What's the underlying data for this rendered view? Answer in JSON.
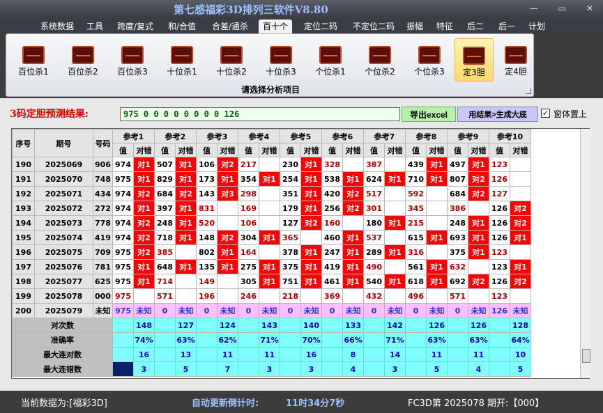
{
  "title": "第七感福彩3D排列三软件V8.80",
  "window_buttons": [
    "—",
    "▭",
    "✕"
  ],
  "menu": [
    "系统数据",
    "工具",
    "跨度/复式",
    "和/合值",
    "合差/通杀",
    "百十个",
    "定位二码",
    "不定位二码",
    "振幅",
    "特征",
    "后二",
    "后一",
    "计划"
  ],
  "active_menu": "百十个",
  "ribbon": {
    "buttons": [
      "百位杀1",
      "百位杀2",
      "百位杀3",
      "十位杀1",
      "十位杀2",
      "十位杀3",
      "个位杀1",
      "个位杀2",
      "个位杀3",
      "定3胆",
      "定4胆"
    ],
    "selected": "定3胆",
    "caption": "请选择分析项目"
  },
  "prediction": {
    "label": "3码定胆预测结果:",
    "value": "975 0 0 0 0 0 0 0 0 126",
    "excel_button": "导出excel",
    "gen_button": "用结果>生成大底",
    "checkbox_label": "窗体置上",
    "checkbox_checked": "✓"
  },
  "table": {
    "headers": {
      "no": "序号",
      "issue": "期号",
      "num": "号码",
      "val": "值",
      "hit": "对错",
      "refs": [
        "参考1",
        "参考2",
        "参考3",
        "参考4",
        "参考5",
        "参考6",
        "参考7",
        "参考8",
        "参考9",
        "参考10"
      ]
    },
    "rows": [
      {
        "no": "190",
        "issue": "2025069",
        "num": "906",
        "cells": [
          [
            "974",
            "对1"
          ],
          [
            "507",
            "对1"
          ],
          [
            "106",
            "对2"
          ],
          [
            "217",
            ""
          ],
          [
            "230",
            "对1"
          ],
          [
            "328",
            ""
          ],
          [
            "387",
            ""
          ],
          [
            "439",
            "对1"
          ],
          [
            "497",
            "对1"
          ],
          [
            "123",
            ""
          ]
        ]
      },
      {
        "no": "191",
        "issue": "2025070",
        "num": "748",
        "cells": [
          [
            "975",
            "对1"
          ],
          [
            "829",
            "对1"
          ],
          [
            "173",
            "对1"
          ],
          [
            "354",
            "对1"
          ],
          [
            "254",
            "对1"
          ],
          [
            "538",
            "对1"
          ],
          [
            "624",
            "对1"
          ],
          [
            "710",
            "对1"
          ],
          [
            "807",
            "对2"
          ],
          [
            "126",
            ""
          ]
        ]
      },
      {
        "no": "192",
        "issue": "2025071",
        "num": "434",
        "cells": [
          [
            "974",
            "对2"
          ],
          [
            "684",
            "对2"
          ],
          [
            "143",
            "对3"
          ],
          [
            "298",
            ""
          ],
          [
            "351",
            "对1"
          ],
          [
            "420",
            "对2"
          ],
          [
            "517",
            ""
          ],
          [
            "592",
            ""
          ],
          [
            "684",
            "对2"
          ],
          [
            "127",
            ""
          ]
        ]
      },
      {
        "no": "193",
        "issue": "2025072",
        "num": "272",
        "cells": [
          [
            "974",
            "对1"
          ],
          [
            "397",
            "对1"
          ],
          [
            "831",
            ""
          ],
          [
            "169",
            ""
          ],
          [
            "179",
            "对1"
          ],
          [
            "256",
            "对2"
          ],
          [
            "301",
            ""
          ],
          [
            "345",
            ""
          ],
          [
            "386",
            ""
          ],
          [
            "126",
            "对2"
          ]
        ]
      },
      {
        "no": "194",
        "issue": "2025073",
        "num": "778",
        "cells": [
          [
            "974",
            "对2"
          ],
          [
            "248",
            "对1"
          ],
          [
            "520",
            ""
          ],
          [
            "106",
            ""
          ],
          [
            "127",
            "对2"
          ],
          [
            "160",
            ""
          ],
          [
            "180",
            "对1"
          ],
          [
            "215",
            ""
          ],
          [
            "248",
            "对1"
          ],
          [
            "126",
            "对2"
          ]
        ]
      },
      {
        "no": "195",
        "issue": "2025074",
        "num": "419",
        "cells": [
          [
            "974",
            "对2"
          ],
          [
            "718",
            "对1"
          ],
          [
            "148",
            "对2"
          ],
          [
            "304",
            "对1"
          ],
          [
            "365",
            ""
          ],
          [
            "460",
            "对1"
          ],
          [
            "537",
            ""
          ],
          [
            "615",
            "对1"
          ],
          [
            "693",
            "对1"
          ],
          [
            "126",
            "对1"
          ]
        ]
      },
      {
        "no": "196",
        "issue": "2025075",
        "num": "709",
        "cells": [
          [
            "975",
            "对2"
          ],
          [
            "385",
            ""
          ],
          [
            "802",
            "对1"
          ],
          [
            "164",
            ""
          ],
          [
            "378",
            "对1"
          ],
          [
            "247",
            "对1"
          ],
          [
            "289",
            "对1"
          ],
          [
            "316",
            ""
          ],
          [
            "375",
            "对1"
          ],
          [
            "123",
            ""
          ]
        ]
      },
      {
        "no": "197",
        "issue": "2025076",
        "num": "781",
        "cells": [
          [
            "975",
            "对1"
          ],
          [
            "648",
            "对1"
          ],
          [
            "135",
            "对1"
          ],
          [
            "275",
            "对1"
          ],
          [
            "375",
            "对1"
          ],
          [
            "419",
            "对1"
          ],
          [
            "490",
            ""
          ],
          [
            "561",
            "对1"
          ],
          [
            "632",
            ""
          ],
          [
            "123",
            "对1"
          ]
        ]
      },
      {
        "no": "198",
        "issue": "2025077",
        "num": "625",
        "cells": [
          [
            "975",
            "对1"
          ],
          [
            "714",
            ""
          ],
          [
            "149",
            ""
          ],
          [
            "305",
            "对1"
          ],
          [
            "751",
            "对1"
          ],
          [
            "461",
            "对1"
          ],
          [
            "540",
            "对1"
          ],
          [
            "618",
            "对1"
          ],
          [
            "692",
            "对2"
          ],
          [
            "126",
            "对2"
          ]
        ]
      },
      {
        "no": "199",
        "issue": "2025078",
        "num": "000",
        "cells": [
          [
            "975",
            ""
          ],
          [
            "571",
            ""
          ],
          [
            "196",
            ""
          ],
          [
            "246",
            ""
          ],
          [
            "218",
            ""
          ],
          [
            "369",
            ""
          ],
          [
            "432",
            ""
          ],
          [
            "496",
            ""
          ],
          [
            "571",
            ""
          ],
          [
            "123",
            ""
          ]
        ]
      },
      {
        "no": "200",
        "issue": "2025079",
        "num": "未知",
        "cells": [
          [
            "975",
            "未知"
          ],
          [
            "0",
            "未知"
          ],
          [
            "0",
            "未知"
          ],
          [
            "0",
            "未知"
          ],
          [
            "0",
            "未知"
          ],
          [
            "0",
            "未知"
          ],
          [
            "0",
            "未知"
          ],
          [
            "0",
            "未知"
          ],
          [
            "0",
            "未知"
          ],
          [
            "126",
            "未知"
          ]
        ]
      }
    ],
    "stats": [
      {
        "label": "对次数",
        "values": [
          "148",
          "127",
          "124",
          "143",
          "140",
          "133",
          "142",
          "126",
          "126",
          "128"
        ]
      },
      {
        "label": "准确率",
        "values": [
          "74%",
          "63%",
          "62%",
          "71%",
          "70%",
          "66%",
          "71%",
          "63%",
          "63%",
          "64%"
        ]
      },
      {
        "label": "最大连对数",
        "values": [
          "16",
          "13",
          "11",
          "11",
          "16",
          "8",
          "14",
          "11",
          "11",
          "10"
        ]
      },
      {
        "label": "最大连错数",
        "values": [
          "3",
          "5",
          "7",
          "3",
          "3",
          "4",
          "3",
          "5",
          "4",
          "5"
        ]
      }
    ]
  },
  "status": {
    "current": "当前数据为:[福彩3D]",
    "countdown_label": "自动更新倒计时:",
    "countdown": "11时34分7秒",
    "draw": "FC3D第 2025078 期开:【000】"
  }
}
